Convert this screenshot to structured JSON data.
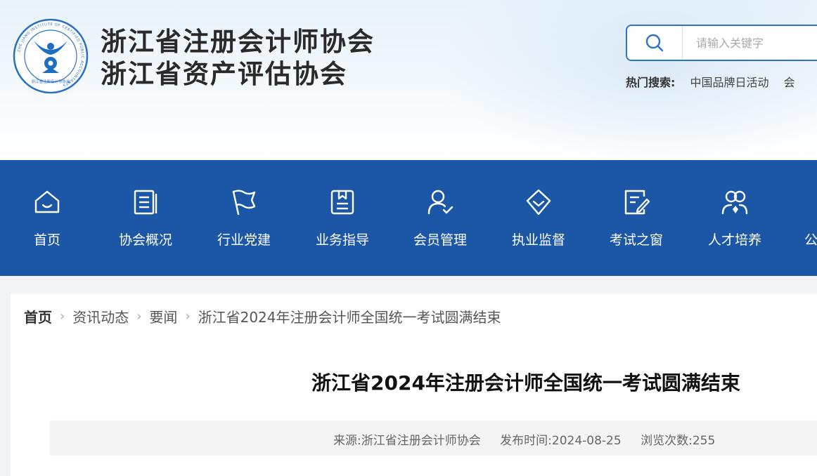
{
  "header": {
    "logo_ring_text": "ZHE JIANG INSTITUTE OF CERTIFIED PUBLIC ACCOUNTANTS",
    "logo_bottom_text": "浙江省注册会计师协会",
    "org_name_1": "浙江省注册会计师协会",
    "org_name_2": "浙江省资产评估协会"
  },
  "search": {
    "placeholder": "请输入关键字",
    "hot_label": "热门搜索:",
    "hot_items": [
      "中国品牌日活动",
      "会"
    ]
  },
  "nav": {
    "items": [
      {
        "label": "首页",
        "icon": "home-icon"
      },
      {
        "label": "协会概况",
        "icon": "document-icon"
      },
      {
        "label": "行业党建",
        "icon": "flag-icon"
      },
      {
        "label": "业务指导",
        "icon": "bookmark-doc-icon"
      },
      {
        "label": "会员管理",
        "icon": "user-check-icon"
      },
      {
        "label": "执业监督",
        "icon": "shield-check-icon"
      },
      {
        "label": "考试之窗",
        "icon": "edit-doc-icon"
      },
      {
        "label": "人才培养",
        "icon": "people-icon"
      },
      {
        "label": "公",
        "icon": ""
      }
    ]
  },
  "breadcrumb": {
    "home": "首页",
    "level1": "资讯动态",
    "level2": "要闻",
    "current": "浙江省2024年注册会计师全国统一考试圆满结束"
  },
  "article": {
    "title": "浙江省2024年注册会计师全国统一考试圆满结束",
    "source_label": "来源:",
    "source": "浙江省注册会计师协会",
    "date_label": "发布时间:",
    "date": "2024-08-25",
    "views_label": "浏览次数:",
    "views": "255"
  },
  "colors": {
    "nav_bg": "#1c56a6",
    "search_border": "#2f73c9",
    "logo_blue": "#1f6fc1"
  }
}
